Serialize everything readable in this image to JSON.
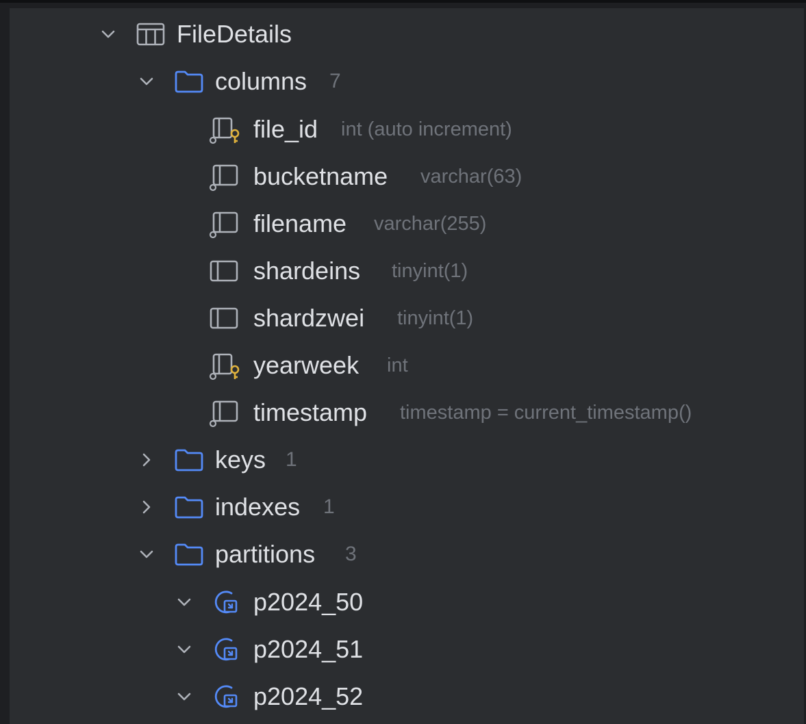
{
  "tree": {
    "table": {
      "name": "FileDetails"
    },
    "columns_folder": {
      "label": "columns",
      "count": "7"
    },
    "columns": [
      {
        "name": "file_id",
        "type": "int (auto increment)",
        "icon": "key-column-icon"
      },
      {
        "name": "bucketname",
        "type": "varchar(63)",
        "icon": "column-not-null-icon"
      },
      {
        "name": "filename",
        "type": "varchar(255)",
        "icon": "column-not-null-icon"
      },
      {
        "name": "shardeins",
        "type": "tinyint(1)",
        "icon": "column-icon"
      },
      {
        "name": "shardzwei",
        "type": "tinyint(1)",
        "icon": "column-icon"
      },
      {
        "name": "yearweek",
        "type": "int",
        "icon": "key-column-icon"
      },
      {
        "name": "timestamp",
        "type": "timestamp = current_timestamp()",
        "icon": "column-not-null-icon"
      }
    ],
    "keys_folder": {
      "label": "keys",
      "count": "1"
    },
    "indexes_folder": {
      "label": "indexes",
      "count": "1"
    },
    "partitions_folder": {
      "label": "partitions",
      "count": "3"
    },
    "partitions": [
      {
        "name": "p2024_50",
        "icon": "partition-icon"
      },
      {
        "name": "p2024_51",
        "icon": "partition-icon"
      },
      {
        "name": "p2024_52",
        "icon": "partition-icon"
      }
    ]
  },
  "colors": {
    "panel_background": "#2b2d30",
    "text": "#dfe1e5",
    "muted_text": "#6f737a",
    "folder_blue": "#548af7",
    "key_gold": "#e0b23c"
  }
}
